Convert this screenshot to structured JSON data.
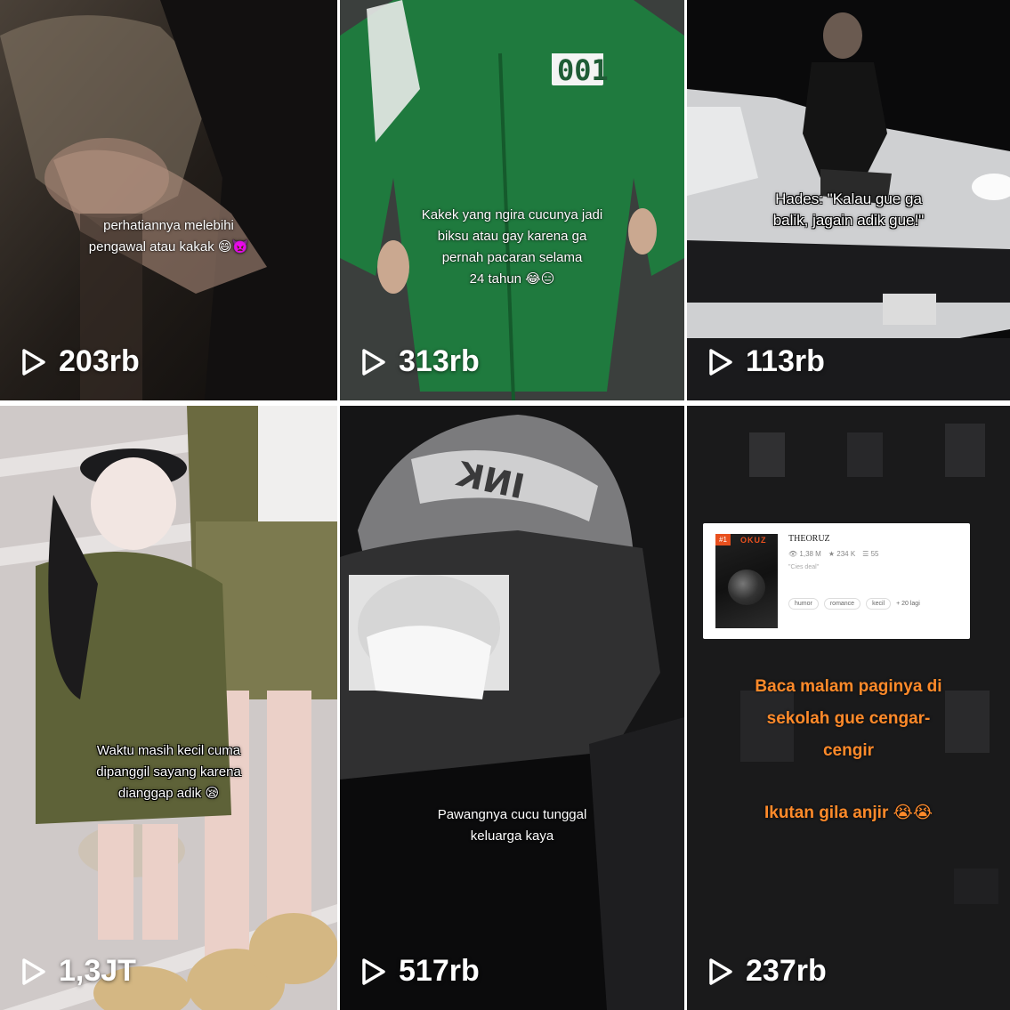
{
  "tiles": [
    {
      "caption": "perhatiannya melebihi\npengawal atau kakak 😄👿",
      "views": "203rb",
      "icon": "play-icon"
    },
    {
      "caption": "Kakek yang ngira cucunya jadi\nbiksu atau gay karena ga\npernah pacaran selama\n24 tahun 😂😑",
      "badge_number": "001",
      "views": "313rb",
      "icon": "play-icon"
    },
    {
      "caption": "Hades: \"Kalau gue ga\nbalik, jagain adik gue!\"",
      "views": "113rb",
      "icon": "play-icon"
    },
    {
      "caption": "Waktu masih kecil cuma\ndipanggil sayang karena\ndianggap adik 😪",
      "views": "1,3JT",
      "icon": "play-icon"
    },
    {
      "caption": "Pawangnya cucu tunggal\nkeluarga kaya",
      "helmet_text": "INK",
      "views": "517rb",
      "icon": "play-icon"
    },
    {
      "caption": "Baca malam paginya di\nsekolah gue cengar-\ncengir",
      "caption2": "Ikutan gila anjir 😭😭",
      "views": "237rb",
      "icon": "play-icon",
      "book_card": {
        "badge": "#1",
        "cover_title": "OKUZ",
        "title": "THEORUZ",
        "reads": "1,38 M",
        "votes": "234 K",
        "parts": "55",
        "quote": "\"Cies deal\"",
        "tags": [
          "humor",
          "romance",
          "kecil"
        ],
        "more": "+ 20 lagi"
      }
    }
  ],
  "colors": {
    "caption_orange": "#ff8a2a",
    "jumpsuit_green": "#1f7a3e",
    "wattpad_orange": "#e8501e"
  }
}
